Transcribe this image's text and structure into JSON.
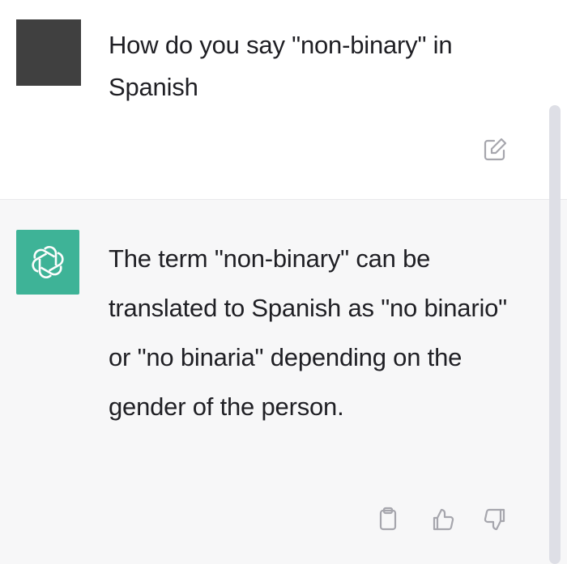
{
  "conversation": {
    "user_message": "How do you say \"non-binary\" in Spanish",
    "assistant_message": "The term \"non-binary\" can be translated to Spanish as \"no binario\" or \"no binaria\" depending on the gender of the person."
  },
  "icons": {
    "user_avatar": "user-avatar",
    "assistant_avatar": "openai-logo-icon",
    "edit": "edit-icon",
    "copy": "clipboard-icon",
    "thumbs_up": "thumbs-up-icon",
    "thumbs_down": "thumbs-down-icon"
  },
  "colors": {
    "assistant_avatar_bg": "#10a37f",
    "user_avatar_bg": "#404040",
    "assistant_bg": "#f7f7f8"
  }
}
